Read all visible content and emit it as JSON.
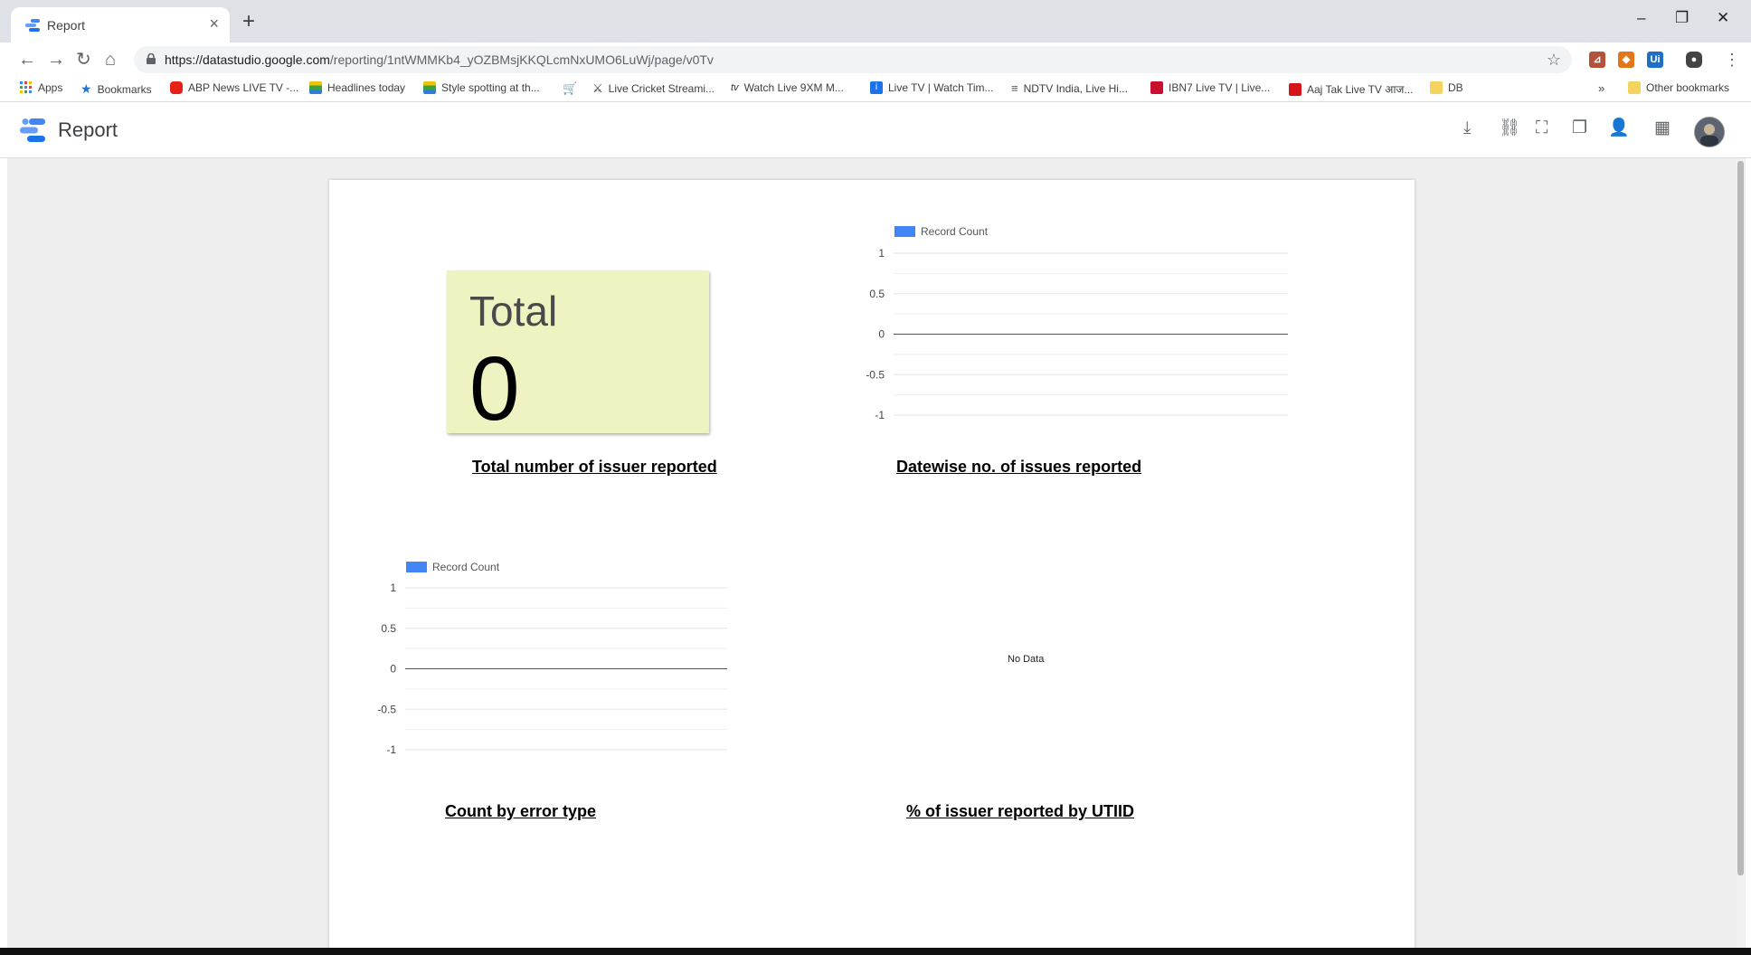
{
  "browser": {
    "tab_title": "Report",
    "tab_close": "×",
    "new_tab": "+",
    "window_controls": {
      "minimize": "–",
      "restore": "❐",
      "close": "✕"
    },
    "nav": {
      "back": "←",
      "forward": "→",
      "reload": "↻",
      "home": "⌂"
    },
    "url_domain": "https://datastudio.google.com",
    "url_path": "/reporting/1ntWMMKb4_yOZBMsjKKQLcmNxUMO6LuWj/page/v0Tv",
    "bookmark_star": "☆",
    "extensions": [
      "pdf-icon",
      "fox-icon",
      "ui-icon",
      "profile-icon"
    ],
    "menu": "⋮"
  },
  "bookmarks": {
    "items": [
      {
        "label": "Apps",
        "icon": "apps-grid-icon"
      },
      {
        "label": "Bookmarks",
        "icon": "star-icon"
      },
      {
        "label": "ABP News LIVE TV -...",
        "icon": "youtube-icon"
      },
      {
        "label": "Headlines today",
        "icon": "headlines-icon"
      },
      {
        "label": "Style spotting at th...",
        "icon": "style-icon"
      },
      {
        "label": "",
        "icon": "cart-icon"
      },
      {
        "label": "Live Cricket Streami...",
        "icon": "cricket-icon"
      },
      {
        "label": "Watch Live 9XM M...",
        "icon": "tv-icon"
      },
      {
        "label": "Live TV | Watch Tim...",
        "icon": "info-icon"
      },
      {
        "label": "NDTV India, Live Hi...",
        "icon": "ndtv-icon"
      },
      {
        "label": "IBN7 Live TV | Live...",
        "icon": "ibn7-icon"
      },
      {
        "label": "Aaj Tak Live TV आज...",
        "icon": "aajtak-icon"
      },
      {
        "label": "DB",
        "icon": "folder-icon"
      }
    ],
    "overflow": "»",
    "other": "Other bookmarks"
  },
  "app": {
    "title": "Report",
    "header_icons": [
      "download-icon",
      "link-icon",
      "fullscreen-icon",
      "copy-icon",
      "share-icon",
      "apps-icon"
    ]
  },
  "scorecard": {
    "label": "Total",
    "value": "0",
    "color": "#eef3c1"
  },
  "titles": {
    "total": "Total number of issuer reported ",
    "datewise": " Datewise no. of issues reported",
    "error_type": "Count by error type ",
    "utiid": "% of issuer reported  by UTIID"
  },
  "no_data": "No Data",
  "chart_data": [
    {
      "type": "bar",
      "title": " Datewise no. of issues reported",
      "series": [
        {
          "name": "Record Count",
          "values": []
        }
      ],
      "ylim": [
        -1,
        1
      ],
      "yticks": [
        "1",
        "0.5",
        "0",
        "-0.5",
        "-1"
      ],
      "legend": "top-left",
      "color": "#4285f4"
    },
    {
      "type": "bar",
      "title": "Count by error type ",
      "series": [
        {
          "name": "Record Count",
          "values": []
        }
      ],
      "ylim": [
        -1,
        1
      ],
      "yticks": [
        "1",
        "0.5",
        "0",
        "-0.5",
        "-1"
      ],
      "legend": "top-left",
      "color": "#4285f4"
    },
    {
      "type": "pie",
      "title": "% of issuer reported  by UTIID",
      "values": []
    }
  ]
}
